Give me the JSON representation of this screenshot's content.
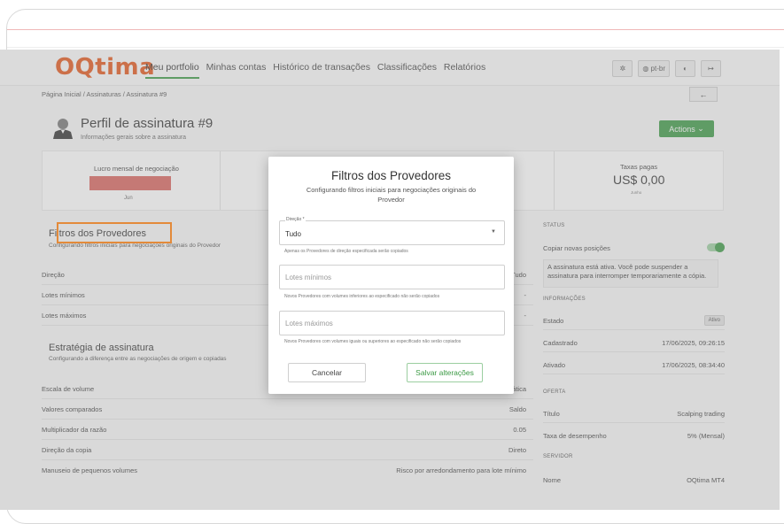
{
  "nav": {
    "logo": "OQtima",
    "links": [
      "Meu portfolio",
      "Minhas contas",
      "Histórico de transações",
      "Classificações",
      "Relatórios"
    ],
    "lang": "pt-br"
  },
  "breadcrumb": "Página Inicial / Assinaturas / Assinatura #9",
  "profile": {
    "title": "Perfil de assinatura #9",
    "subtitle": "Informações gerais sobre a assinatura",
    "actions_label": "Actions"
  },
  "stats": {
    "profit_label": "Lucro mensal de negociação",
    "month": "Jun",
    "fees_label": "Taxas pagas",
    "fees_value": "US$ 0,00",
    "fees_sub": "Junho"
  },
  "filters_section": {
    "title": "Filtros dos Provedores",
    "subtitle": "Configurando filtros iniciais para negociações originais do Provedor",
    "rows": [
      {
        "k": "Direção",
        "v": "Tudo"
      },
      {
        "k": "Lotes mínimos",
        "v": "-"
      },
      {
        "k": "Lotes máximos",
        "v": "-"
      }
    ]
  },
  "strategy_section": {
    "title": "Estratégia de assinatura",
    "subtitle": "Configurando a diferença entre as negociações de origem e copiadas",
    "rows": [
      {
        "k": "Escala de volume",
        "v": "Escala automática"
      },
      {
        "k": "Valores comparados",
        "v": "Saldo"
      },
      {
        "k": "Multiplicador da razão",
        "v": "0.05"
      },
      {
        "k": "Direção da copia",
        "v": "Direto"
      },
      {
        "k": "Manuseio de pequenos volumes",
        "v": "Risco por arredondamento para lote mínimo"
      }
    ]
  },
  "right": {
    "status_head": "STATUS",
    "copy_label": "Copiar novas posições",
    "note": "A assinatura está ativa. Você pode suspender a assinatura para interromper temporariamente a cópia.",
    "info_head": "INFORMAÇÕES",
    "estado_k": "Estado",
    "estado_v": "Ativo",
    "cadastrado_k": "Cadastrado",
    "cadastrado_v": "17/06/2025, 09:26:15",
    "ativado_k": "Ativado",
    "ativado_v": "17/06/2025, 08:34:40",
    "oferta_head": "OFERTA",
    "titulo_k": "Título",
    "titulo_v": "Scalping trading",
    "taxa_k": "Taxa de desempenho",
    "taxa_v": "5% (Mensal)",
    "servidor_head": "SERVIDOR",
    "nome_k": "Nome",
    "nome_v": "OQtima MT4"
  },
  "modal": {
    "title": "Filtros dos Provedores",
    "subtitle": "Configurando filtros iniciais para negociações originais do Provedor",
    "direction_label": "Direção *",
    "direction_value": "Tudo",
    "direction_help": "Apenas os Provedores de direção especificada serão copiados",
    "min_placeholder": "Lotes mínimos",
    "min_help": "Novos Provedores com volumes inferiores ao especificado não serão copiados",
    "max_placeholder": "Lotes máximos",
    "max_help": "Novos Provedores com volumes iguais ou superiores ao especificado não serão copiados",
    "cancel_label": "Cancelar",
    "save_label": "Salvar alterações"
  }
}
